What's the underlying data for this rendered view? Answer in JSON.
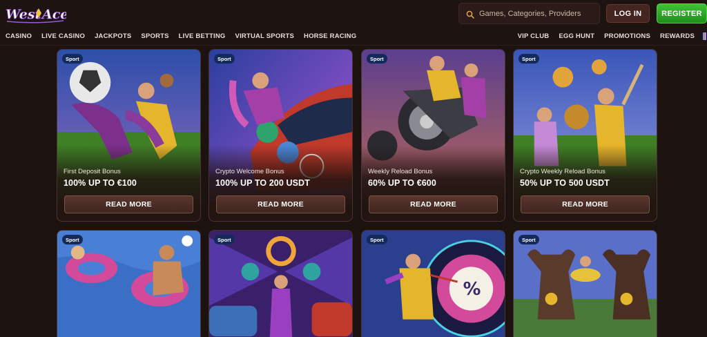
{
  "header": {
    "logo_text": "West Ace",
    "search_placeholder": "Games, Categories, Providers",
    "login_label": "LOG IN",
    "register_label": "REGISTER"
  },
  "nav": {
    "left": [
      "CASINO",
      "LIVE CASINO",
      "JACKPOTS",
      "SPORTS",
      "LIVE BETTING",
      "VIRTUAL SPORTS",
      "HORSE RACING"
    ],
    "right": [
      "VIP CLUB",
      "EGG HUNT",
      "PROMOTIONS",
      "REWARDS"
    ]
  },
  "cards": [
    {
      "badge": "Sport",
      "subtitle": "First Deposit Bonus",
      "title": "100% UP TO €100",
      "button": "READ MORE",
      "theme": "soccer"
    },
    {
      "badge": "Sport",
      "subtitle": "Crypto Welcome Bonus",
      "title": "100% UP TO 200 USDT",
      "button": "READ MORE",
      "theme": "racecar"
    },
    {
      "badge": "Sport",
      "subtitle": "Weekly Reload Bonus",
      "title": "60% UP TO €600",
      "button": "READ MORE",
      "theme": "quad-bike"
    },
    {
      "badge": "Sport",
      "subtitle": "Crypto Weekly Reload Bonus",
      "title": "50% UP TO 500 USDT",
      "button": "READ MORE",
      "theme": "baseball"
    },
    {
      "badge": "Sport",
      "theme": "pool-float"
    },
    {
      "badge": "Sport",
      "theme": "crypto-wings"
    },
    {
      "badge": "Sport",
      "theme": "dartboard"
    },
    {
      "badge": "Sport",
      "theme": "bulls"
    }
  ],
  "colors": {
    "background": "#1c1210",
    "register": "#2aa823",
    "login": "#452520",
    "badge": "#142a5a"
  }
}
